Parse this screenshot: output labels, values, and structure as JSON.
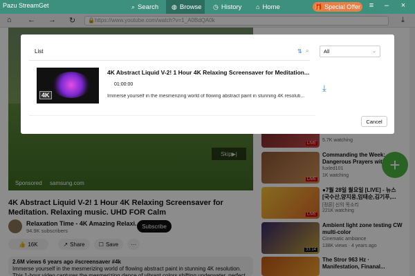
{
  "app": {
    "title": "Pazu StreamGet"
  },
  "nav_tabs": [
    {
      "label": "Search"
    },
    {
      "label": "Browse"
    },
    {
      "label": "History"
    },
    {
      "label": "Home"
    }
  ],
  "special_offer": "Special Offer",
  "browser": {
    "url": "https://www.youtube.com/watch?v=1_A0BdQA0k"
  },
  "video": {
    "sponsored": "Sponsored",
    "ad_site": "samsung.com",
    "skip": "Skip",
    "title": "4K Abstract Liquid V-2! 1 Hour 4K Relaxing Screensaver for Meditation. Relaxing music. UHD FOR Calm",
    "channel": "Relaxation Time - 4K Amazing Relaxi...",
    "subscribers": "94.9K subscribers",
    "subscribe": "Subscribe",
    "likes": "16K",
    "share": "Share",
    "save": "Save",
    "more": "···",
    "views_meta": "2.6M views  6 years ago  #screensaver #4k",
    "description": "Immerse yourself in the mesmerizing world of flowing abstract paint in stunning 4K resolution. This 1-hour video captures the mesmerizing dance of vibrant colors shifting underwater, perfect for relaxation, meditation, or"
  },
  "recommendations": [
    {
      "title": "",
      "channel": "",
      "meta": "5.7K watching",
      "badge": "LIVE",
      "colors": [
        "#7a2a2a",
        "#c44b4b"
      ]
    },
    {
      "title": "Commanding the Week: Dangerous Prayers with ...",
      "channel": "fuxled101",
      "meta": "1K watching",
      "badge": "LIVE",
      "colors": [
        "#8c5a3a",
        "#d09056"
      ]
    },
    {
      "title": "●7월 28일 월요일 [LIVE] - 뉴스 [국수산,양지웅,임태순,김기푸,...",
      "channel": "[정론] 신의 목소리",
      "meta": "221K watching",
      "badge": "LIVE",
      "colors": [
        "#f4c33a",
        "#e06b2a"
      ]
    },
    {
      "title": "Ambient light zone testing CW multi-color",
      "channel": "Cinematic ambiance",
      "meta": "138K views · 4 years ago",
      "badge": "33:14",
      "colors": [
        "#3a2a6a",
        "#c4a23a"
      ]
    },
    {
      "title": "The Stror 963 Hz · Manifestation, Finanal...",
      "channel": "",
      "meta": "",
      "badge": "",
      "colors": [
        "#c25a1a",
        "#f0a030"
      ]
    }
  ],
  "modal": {
    "list_label": "List",
    "filter_value": "All",
    "item": {
      "title": "4K Abstract Liquid V-2! 1 Hour 4K Relaxing Screensaver for Meditation...",
      "duration": "01:00:00",
      "description": "Immerse yourself in the mesmerizing world of flowing abstract paint in stunning 4K resoluti..."
    },
    "cancel": "Cancel"
  },
  "colors": {
    "brand": "#3d8f7e",
    "offer": "#e97e47",
    "accent": "#3b7bd4",
    "fab": "#4bb543"
  }
}
